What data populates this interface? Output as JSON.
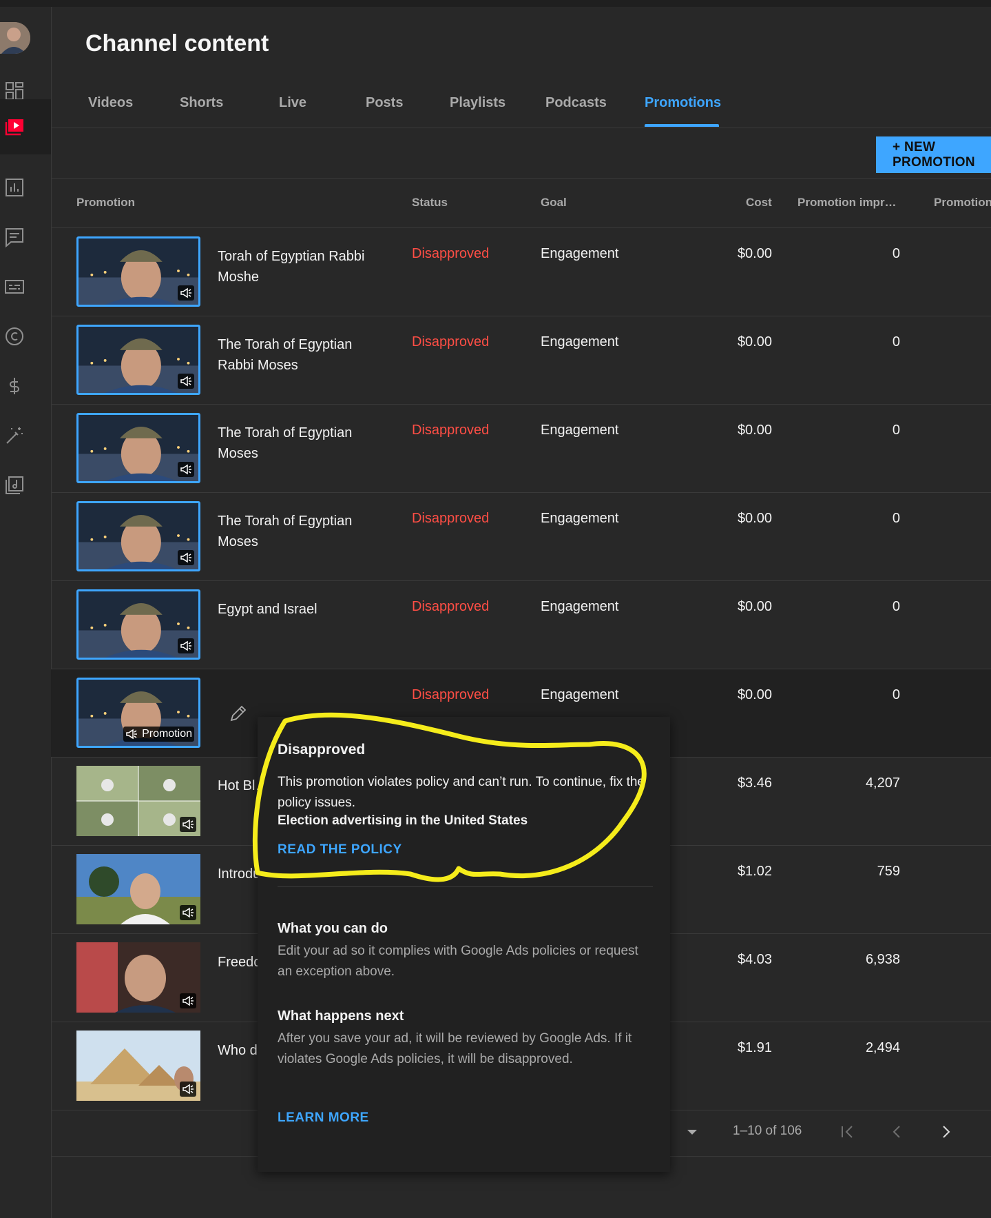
{
  "page": {
    "title": "Channel content"
  },
  "tabs": [
    {
      "label": "Videos"
    },
    {
      "label": "Shorts"
    },
    {
      "label": "Live"
    },
    {
      "label": "Posts"
    },
    {
      "label": "Playlists"
    },
    {
      "label": "Podcasts"
    },
    {
      "label": "Promotions",
      "active": true
    }
  ],
  "toolbar": {
    "new_promotion_label": "+ NEW PROMOTION"
  },
  "table": {
    "headers": {
      "promotion": "Promotion",
      "status": "Status",
      "goal": "Goal",
      "cost": "Cost",
      "impressions": "Promotion impr…",
      "more": "Promotion"
    },
    "rows": [
      {
        "title": "Torah of Egyptian Rabbi Moshe",
        "status": "Disapproved",
        "goal": "Engagement",
        "cost": "$0.00",
        "impressions": "0"
      },
      {
        "title": "The Torah of Egyptian Rabbi Moses",
        "status": "Disapproved",
        "goal": "Engagement",
        "cost": "$0.00",
        "impressions": "0"
      },
      {
        "title": "The Torah of Egyptian Moses",
        "status": "Disapproved",
        "goal": "Engagement",
        "cost": "$0.00",
        "impressions": "0"
      },
      {
        "title": "The Torah of Egyptian Moses",
        "status": "Disapproved",
        "goal": "Engagement",
        "cost": "$0.00",
        "impressions": "0"
      },
      {
        "title": "Egypt and Israel",
        "status": "Disapproved",
        "goal": "Engagement",
        "cost": "$0.00",
        "impressions": "0"
      },
      {
        "title": "",
        "status": "Disapproved",
        "goal": "Engagement",
        "cost": "$0.00",
        "impressions": "0",
        "badge": "Promotion"
      },
      {
        "title": "Hot Bl… Cold V…",
        "status": "",
        "goal": "",
        "cost": "$3.46",
        "impressions": "4,207"
      },
      {
        "title": "Introdu…",
        "status": "",
        "goal": "",
        "cost": "$1.02",
        "impressions": "759"
      },
      {
        "title": "Freedo… Egypt",
        "status": "",
        "goal": "",
        "cost": "$4.03",
        "impressions": "6,938"
      },
      {
        "title": "Who d… to?",
        "status": "",
        "goal": "",
        "cost": "$1.91",
        "impressions": "2,494"
      }
    ]
  },
  "pagination": {
    "range": "1–10 of 106"
  },
  "popover": {
    "heading": "Disapproved",
    "message": "This promotion violates policy and can’t run. To continue, fix the policy issues.",
    "policy": "Election advertising in the United States",
    "read_policy": "READ THE POLICY",
    "what_you_can_do_title": "What you can do",
    "what_you_can_do_text": "Edit your ad so it complies with Google Ads policies or request an exception above.",
    "what_happens_next_title": "What happens next",
    "what_happens_next_text": "After you save your ad, it will be reviewed by Google Ads. If it violates Google Ads policies, it will be disapproved.",
    "learn_more": "LEARN MORE"
  },
  "colors": {
    "accent": "#3ea6ff",
    "error": "#ff4e45",
    "highlight": "#f5ec1b",
    "background": "#282828"
  },
  "icons": [
    "dashboard-icon",
    "content-icon",
    "analytics-icon",
    "comments-icon",
    "subtitles-icon",
    "copyright-icon",
    "earn-icon",
    "customization-icon",
    "audio-library-icon",
    "promotion-megaphone-icon",
    "edit-pencil-icon"
  ]
}
